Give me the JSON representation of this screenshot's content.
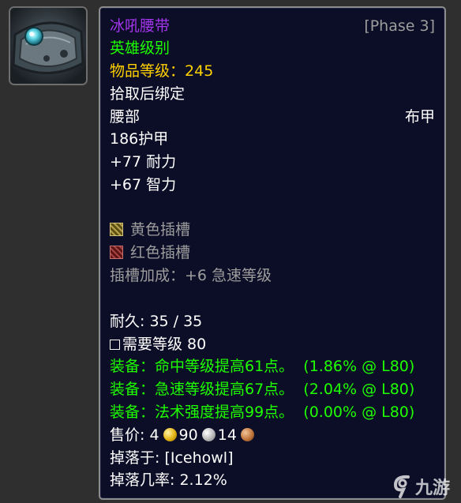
{
  "item": {
    "name": "冰吼腰带",
    "phase": "[Phase 3]",
    "quality": "英雄级别",
    "item_level_label": "物品等级：",
    "item_level": "245",
    "bind": "拾取后绑定",
    "slot": "腰部",
    "armor_type": "布甲",
    "armor": "186护甲",
    "stats": [
      "+77 耐力",
      "+67 智力"
    ],
    "sockets": [
      {
        "label": "黄色插槽",
        "color": "#b7a04a"
      },
      {
        "label": "红色插槽",
        "color": "#a84242"
      }
    ],
    "socket_bonus": "插槽加成：+6 急速等级",
    "durability": "耐久: 35 / 35",
    "required_level": "需要等级 80",
    "equip_effects": [
      {
        "text": "装备：命中等级提高61点。",
        "value": "(1.86% @ L80)"
      },
      {
        "text": "装备：急速等级提高67点。",
        "value": "(2.04% @ L80)"
      },
      {
        "text": "装备：法术强度提高99点。",
        "value": "(0.00% @ L80)"
      }
    ],
    "sell_price": {
      "label": "售价: ",
      "gold": "4",
      "silver": "90",
      "copper": "14"
    },
    "dropped_by": "掉落于: [Icehowl]",
    "drop_rate": "掉落几率: 2.12%"
  },
  "icon": {
    "name": "belt-icon"
  },
  "watermark": {
    "text": "九游"
  },
  "colors": {
    "epic": "#a335ee",
    "uncommon": "#1eff00",
    "gold": "#ffd100",
    "grey": "#9d9d9d",
    "background": "#0c0d26",
    "border": "#8d8d8d"
  }
}
